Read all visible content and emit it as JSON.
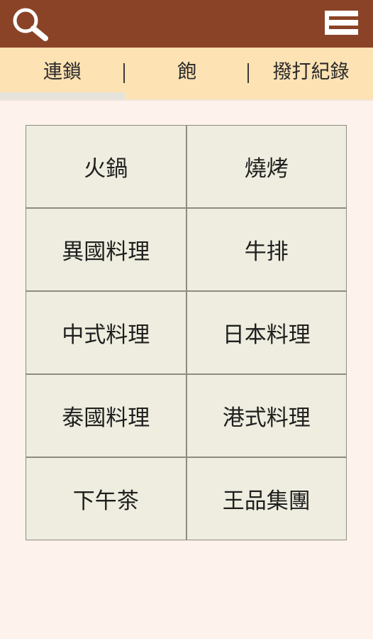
{
  "header": {
    "search_icon": "search-icon",
    "menu_icon": "menu-icon",
    "bar_color": "#8a4327"
  },
  "tabs": [
    {
      "label": "連鎖",
      "active": true
    },
    {
      "label": "飽",
      "active": false
    },
    {
      "label": "撥打紀錄",
      "active": false
    }
  ],
  "tabbar_color": "#fde2b4",
  "categories": [
    {
      "label": "火鍋"
    },
    {
      "label": "燒烤"
    },
    {
      "label": "異國料理"
    },
    {
      "label": "牛排"
    },
    {
      "label": "中式料理"
    },
    {
      "label": "日本料理"
    },
    {
      "label": "泰國料理"
    },
    {
      "label": "港式料理"
    },
    {
      "label": "下午茶"
    },
    {
      "label": "王品集團"
    }
  ]
}
